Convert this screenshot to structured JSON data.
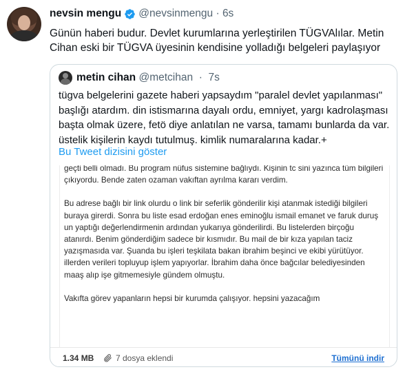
{
  "tweet": {
    "author_name": "nevsin mengu",
    "handle": "@nevsinmengu",
    "time": "6s",
    "text": "Günün haberi budur. Devlet kurumlarına yerleştirilen TÜGVAlılar. Metin Cihan eski bir TÜGVA üyesinin kendisine yolladığı belgeleri paylaşıyor",
    "verified_color": "#1d9bf0",
    "link_color": "#1d9bf0"
  },
  "quote": {
    "author_name": "metin cihan",
    "handle": "@metcihan",
    "time": "7s",
    "text": "tügva belgelerini gazete haberi yapsaydım \"paralel devlet yapılanması\" başlığı atardım. din istismarına dayalı ordu, emniyet, yargı kadrolaşması başta olmak üzere, fetö diye anlatılan ne varsa, tamamı bunlarda da var. üstelik kişilerin kaydı tutulmuş. kimlik numaralarına kadar.+",
    "thread_link": "Bu Tweet dizisini göster"
  },
  "document": {
    "paragraphs": [
      "geçti belli olmadı. Bu program nüfus sistemine bağlıydı. Kişinin tc sini yazınca tüm bilgileri çıkıyordu. Bende zaten ozaman vakıftan ayrılma kararı verdim.",
      "Bu adrese bağlı bir link olurdu o link bir seferlik gönderilir kişi atanmak istediği bilgileri buraya girerdi. Sonra bu liste esad erdoğan enes eminoğlu ismail emanet ve faruk duruş un yaptığı değerlendirmenin ardından yukarıya gönderilirdi. Bu listelerden birçoğu atanırdı. Benim gönderdiğim sadece bir kısmıdır. Bu mail de bir kıza yapılan taciz yazışmasıda var. Şuanda bu işleri teşkilata bakan ibrahim beşinci ve ekibi yürütüyor. illerden verileri topluyup işlem yapıyorlar. İbrahim daha önce bağcılar belediyesinden maaş alıp işe gitmemesiyle gündem olmuştu.",
      "Vakıfta görev yapanların hepsi bir kurumda çalışıyor. hepsini yazacağım"
    ],
    "file_size": "1.34 MB",
    "file_count": "7 dosya eklendi",
    "download_label": "Tümünü indir",
    "clip_icon": "paperclip-icon"
  }
}
